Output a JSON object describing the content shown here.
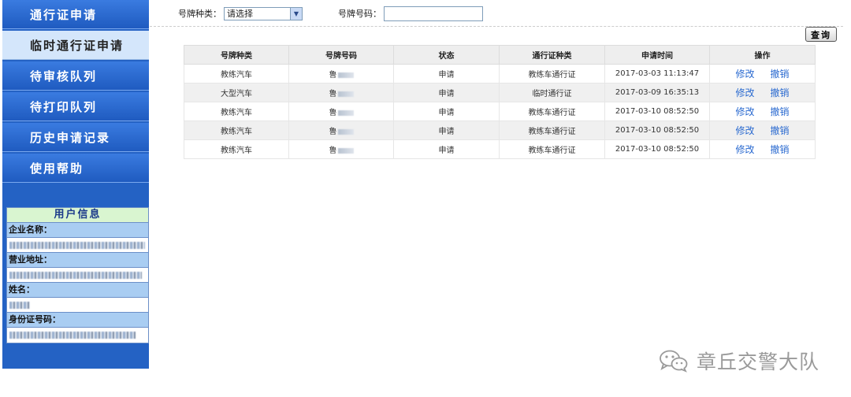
{
  "sidebar": {
    "items": [
      {
        "label": "通行证申请",
        "active": false
      },
      {
        "label": "临时通行证申请",
        "active": true
      },
      {
        "label": "待审核队列",
        "active": false
      },
      {
        "label": "待打印队列",
        "active": false
      },
      {
        "label": "历史申请记录",
        "active": false
      },
      {
        "label": "使用帮助",
        "active": false
      }
    ]
  },
  "user_info": {
    "title": "用户信息",
    "fields": [
      {
        "label": "企业名称："
      },
      {
        "label": "营业地址："
      },
      {
        "label": "姓名："
      },
      {
        "label": "身份证号码："
      }
    ]
  },
  "filter": {
    "plate_type_label": "号牌种类：",
    "plate_type_value": "请选择",
    "plate_no_label": "号牌号码：",
    "plate_no_value": "",
    "query_label": "查询"
  },
  "table": {
    "headers": [
      "号牌种类",
      "号牌号码",
      "状态",
      "通行证种类",
      "申请时间",
      "操作"
    ],
    "rows": [
      {
        "plate_type": "教练汽车",
        "plate_prefix": "鲁",
        "status": "申请",
        "pass_type": "教练车通行证",
        "time": "2017-03-03 11:13:47",
        "op_edit": "修改",
        "op_cancel": "撤销"
      },
      {
        "plate_type": "大型汽车",
        "plate_prefix": "鲁",
        "status": "申请",
        "pass_type": "临时通行证",
        "time": "2017-03-09 16:35:13",
        "op_edit": "修改",
        "op_cancel": "撤销"
      },
      {
        "plate_type": "教练汽车",
        "plate_prefix": "鲁",
        "status": "申请",
        "pass_type": "教练车通行证",
        "time": "2017-03-10 08:52:50",
        "op_edit": "修改",
        "op_cancel": "撤销"
      },
      {
        "plate_type": "教练汽车",
        "plate_prefix": "鲁",
        "status": "申请",
        "pass_type": "教练车通行证",
        "time": "2017-03-10 08:52:50",
        "op_edit": "修改",
        "op_cancel": "撤销"
      },
      {
        "plate_type": "教练汽车",
        "plate_prefix": "鲁",
        "status": "申请",
        "pass_type": "教练车通行证",
        "time": "2017-03-10 08:52:50",
        "op_edit": "修改",
        "op_cancel": "撤销"
      }
    ]
  },
  "watermark": {
    "text": "章丘交警大队",
    "icon": "wechat-icon"
  },
  "colors": {
    "sidebar": "#2462c4",
    "sidebar_active": "#d4e6fb",
    "link": "#2a6ad0"
  }
}
